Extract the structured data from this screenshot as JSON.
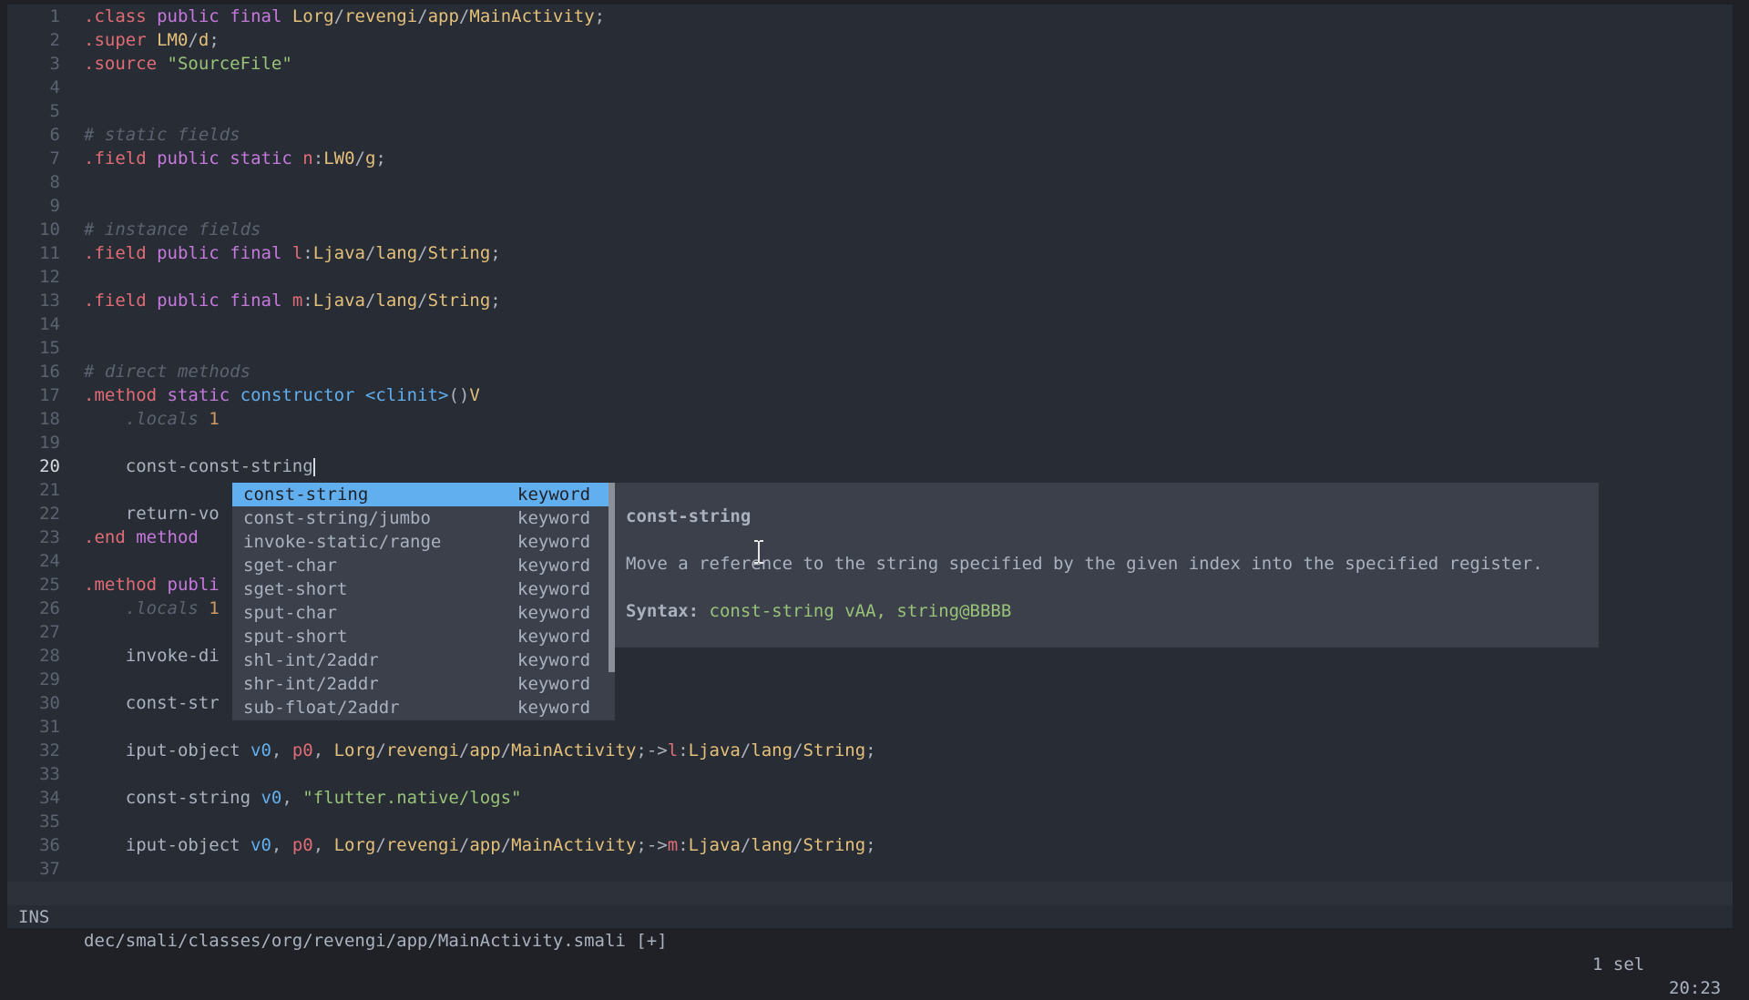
{
  "editor": {
    "current_line": 20,
    "lines": [
      {
        "n": "1",
        "tokens": [
          [
            "directive",
            ".class"
          ],
          [
            "plain",
            " "
          ],
          [
            "keyword",
            "public"
          ],
          [
            "plain",
            " "
          ],
          [
            "keyword",
            "final"
          ],
          [
            "plain",
            " "
          ],
          [
            "type",
            "Lorg"
          ],
          [
            "plain",
            "/"
          ],
          [
            "type",
            "revengi"
          ],
          [
            "plain",
            "/"
          ],
          [
            "type",
            "app"
          ],
          [
            "plain",
            "/"
          ],
          [
            "type",
            "MainActivity"
          ],
          [
            "plain",
            ";"
          ]
        ]
      },
      {
        "n": "2",
        "tokens": [
          [
            "directive",
            ".super"
          ],
          [
            "plain",
            " "
          ],
          [
            "type",
            "LM0"
          ],
          [
            "plain",
            "/"
          ],
          [
            "type",
            "d"
          ],
          [
            "plain",
            ";"
          ]
        ]
      },
      {
        "n": "3",
        "tokens": [
          [
            "directive",
            ".source"
          ],
          [
            "plain",
            " "
          ],
          [
            "string",
            "\"SourceFile\""
          ]
        ]
      },
      {
        "n": "4",
        "tokens": []
      },
      {
        "n": "5",
        "tokens": []
      },
      {
        "n": "6",
        "tokens": [
          [
            "comment",
            "# static fields"
          ]
        ]
      },
      {
        "n": "7",
        "tokens": [
          [
            "directive",
            ".field"
          ],
          [
            "plain",
            " "
          ],
          [
            "keyword",
            "public"
          ],
          [
            "plain",
            " "
          ],
          [
            "keyword",
            "static"
          ],
          [
            "plain",
            " "
          ],
          [
            "field",
            "n"
          ],
          [
            "plain",
            ":"
          ],
          [
            "type",
            "LW0"
          ],
          [
            "plain",
            "/"
          ],
          [
            "type",
            "g"
          ],
          [
            "plain",
            ";"
          ]
        ]
      },
      {
        "n": "8",
        "tokens": []
      },
      {
        "n": "9",
        "tokens": []
      },
      {
        "n": "10",
        "tokens": [
          [
            "comment",
            "# instance fields"
          ]
        ]
      },
      {
        "n": "11",
        "tokens": [
          [
            "directive",
            ".field"
          ],
          [
            "plain",
            " "
          ],
          [
            "keyword",
            "public"
          ],
          [
            "plain",
            " "
          ],
          [
            "keyword",
            "final"
          ],
          [
            "plain",
            " "
          ],
          [
            "field",
            "l"
          ],
          [
            "plain",
            ":"
          ],
          [
            "type",
            "Ljava"
          ],
          [
            "plain",
            "/"
          ],
          [
            "type",
            "lang"
          ],
          [
            "plain",
            "/"
          ],
          [
            "type",
            "String"
          ],
          [
            "plain",
            ";"
          ]
        ]
      },
      {
        "n": "12",
        "tokens": []
      },
      {
        "n": "13",
        "tokens": [
          [
            "directive",
            ".field"
          ],
          [
            "plain",
            " "
          ],
          [
            "keyword",
            "public"
          ],
          [
            "plain",
            " "
          ],
          [
            "keyword",
            "final"
          ],
          [
            "plain",
            " "
          ],
          [
            "field",
            "m"
          ],
          [
            "plain",
            ":"
          ],
          [
            "type",
            "Ljava"
          ],
          [
            "plain",
            "/"
          ],
          [
            "type",
            "lang"
          ],
          [
            "plain",
            "/"
          ],
          [
            "type",
            "String"
          ],
          [
            "plain",
            ";"
          ]
        ]
      },
      {
        "n": "14",
        "tokens": []
      },
      {
        "n": "15",
        "tokens": []
      },
      {
        "n": "16",
        "tokens": [
          [
            "comment",
            "# direct methods"
          ]
        ]
      },
      {
        "n": "17",
        "tokens": [
          [
            "directive",
            ".method"
          ],
          [
            "plain",
            " "
          ],
          [
            "keyword",
            "static"
          ],
          [
            "plain",
            " "
          ],
          [
            "func",
            "constructor"
          ],
          [
            "plain",
            " "
          ],
          [
            "func",
            "<clinit>"
          ],
          [
            "plain",
            "()"
          ],
          [
            "type",
            "V"
          ]
        ]
      },
      {
        "n": "18",
        "tokens": [
          [
            "plain",
            "    "
          ],
          [
            "comment",
            ".locals"
          ],
          [
            "plain",
            " "
          ],
          [
            "num",
            "1"
          ]
        ]
      },
      {
        "n": "19",
        "tokens": []
      },
      {
        "n": "20",
        "tokens": [
          [
            "plain",
            "    const-const-string"
          ]
        ],
        "cursor": true
      },
      {
        "n": "21",
        "tokens": []
      },
      {
        "n": "22",
        "tokens": [
          [
            "plain",
            "    return-vo"
          ]
        ]
      },
      {
        "n": "23",
        "tokens": [
          [
            "directive",
            ".end"
          ],
          [
            "plain",
            " "
          ],
          [
            "keyword",
            "method"
          ]
        ]
      },
      {
        "n": "24",
        "tokens": []
      },
      {
        "n": "25",
        "tokens": [
          [
            "directive",
            ".method"
          ],
          [
            "plain",
            " "
          ],
          [
            "keyword",
            "publi"
          ]
        ]
      },
      {
        "n": "26",
        "tokens": [
          [
            "plain",
            "    "
          ],
          [
            "comment",
            ".locals"
          ],
          [
            "plain",
            " "
          ],
          [
            "num",
            "1"
          ]
        ]
      },
      {
        "n": "27",
        "tokens": []
      },
      {
        "n": "28",
        "tokens": [
          [
            "plain",
            "    invoke-di"
          ]
        ]
      },
      {
        "n": "29",
        "tokens": []
      },
      {
        "n": "30",
        "tokens": [
          [
            "plain",
            "    const-str"
          ]
        ]
      },
      {
        "n": "31",
        "tokens": []
      },
      {
        "n": "32",
        "tokens": [
          [
            "plain",
            "    iput-object "
          ],
          [
            "reg",
            "v0"
          ],
          [
            "plain",
            ", "
          ],
          [
            "param",
            "p0"
          ],
          [
            "plain",
            ", "
          ],
          [
            "type",
            "Lorg"
          ],
          [
            "plain",
            "/"
          ],
          [
            "type",
            "revengi"
          ],
          [
            "plain",
            "/"
          ],
          [
            "type",
            "app"
          ],
          [
            "plain",
            "/"
          ],
          [
            "type",
            "MainActivity"
          ],
          [
            "plain",
            ";->"
          ],
          [
            "field",
            "l"
          ],
          [
            "plain",
            ":"
          ],
          [
            "type",
            "Ljava"
          ],
          [
            "plain",
            "/"
          ],
          [
            "type",
            "lang"
          ],
          [
            "plain",
            "/"
          ],
          [
            "type",
            "String"
          ],
          [
            "plain",
            ";"
          ]
        ]
      },
      {
        "n": "33",
        "tokens": []
      },
      {
        "n": "34",
        "tokens": [
          [
            "plain",
            "    const-string "
          ],
          [
            "reg",
            "v0"
          ],
          [
            "plain",
            ", "
          ],
          [
            "string",
            "\"flutter.native/logs\""
          ]
        ]
      },
      {
        "n": "35",
        "tokens": []
      },
      {
        "n": "36",
        "tokens": [
          [
            "plain",
            "    iput-object "
          ],
          [
            "reg",
            "v0"
          ],
          [
            "plain",
            ", "
          ],
          [
            "param",
            "p0"
          ],
          [
            "plain",
            ", "
          ],
          [
            "type",
            "Lorg"
          ],
          [
            "plain",
            "/"
          ],
          [
            "type",
            "revengi"
          ],
          [
            "plain",
            "/"
          ],
          [
            "type",
            "app"
          ],
          [
            "plain",
            "/"
          ],
          [
            "type",
            "MainActivity"
          ],
          [
            "plain",
            ";->"
          ],
          [
            "field",
            "m"
          ],
          [
            "plain",
            ":"
          ],
          [
            "type",
            "Ljava"
          ],
          [
            "plain",
            "/"
          ],
          [
            "type",
            "lang"
          ],
          [
            "plain",
            "/"
          ],
          [
            "type",
            "String"
          ],
          [
            "plain",
            ";"
          ]
        ]
      },
      {
        "n": "37",
        "tokens": []
      }
    ]
  },
  "completion": {
    "selected_index": 0,
    "items": [
      {
        "label": "const-string",
        "kind": "keyword"
      },
      {
        "label": "const-string/jumbo",
        "kind": "keyword"
      },
      {
        "label": "invoke-static/range",
        "kind": "keyword"
      },
      {
        "label": "sget-char",
        "kind": "keyword"
      },
      {
        "label": "sget-short",
        "kind": "keyword"
      },
      {
        "label": "sput-char",
        "kind": "keyword"
      },
      {
        "label": "sput-short",
        "kind": "keyword"
      },
      {
        "label": "shl-int/2addr",
        "kind": "keyword"
      },
      {
        "label": "shr-int/2addr",
        "kind": "keyword"
      },
      {
        "label": "sub-float/2addr",
        "kind": "keyword"
      }
    ]
  },
  "doc": {
    "title": "const-string",
    "description": "Move a reference to the string specified by the given index into the specified register.",
    "syntax_label": "Syntax:",
    "syntax_value": "const-string vAA, string@BBBB"
  },
  "statusbar": {
    "mode": "INS",
    "file_path": "dec/smali/classes/org/revengi/app/MainActivity.smali [+]",
    "selections": "1 sel",
    "position": "20:23"
  }
}
